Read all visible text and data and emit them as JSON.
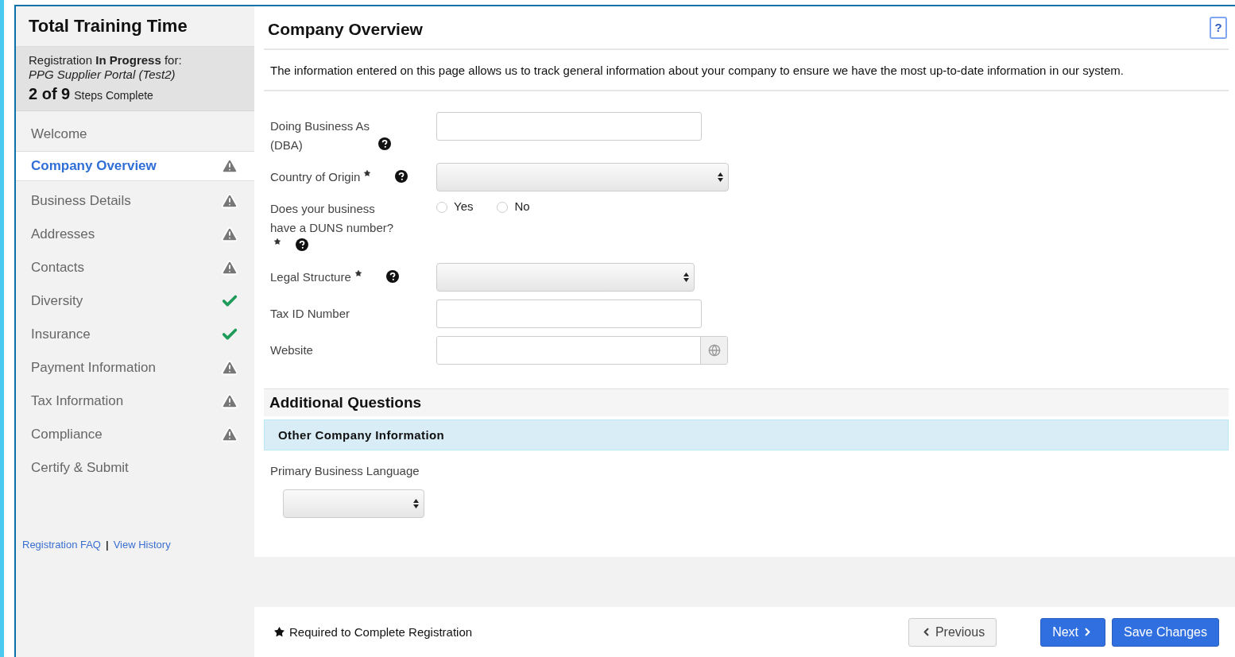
{
  "sidebar": {
    "title": "Total Training Time",
    "status": "Registration **In Progress** for:",
    "portal": "PPG Supplier Portal (Test2)",
    "progress": "2 of 9",
    "progress_suffix": "Steps Complete",
    "steps": [
      {
        "label": "Welcome",
        "selected": false,
        "kind": "plain"
      },
      {
        "label": "Company Overview",
        "selected": true,
        "kind": "warning"
      },
      {
        "label": "Business Details",
        "selected": false,
        "kind": "warning"
      },
      {
        "label": "Addresses",
        "selected": false,
        "kind": "warning"
      },
      {
        "label": "Contacts",
        "selected": false,
        "kind": "warning"
      },
      {
        "label": "Diversity",
        "selected": false,
        "kind": "done"
      },
      {
        "label": "Insurance",
        "selected": false,
        "kind": "done"
      },
      {
        "label": "Payment Information",
        "selected": false,
        "kind": "warning"
      },
      {
        "label": "Tax Information",
        "selected": false,
        "kind": "warning"
      },
      {
        "label": "Compliance",
        "selected": false,
        "kind": "warning"
      },
      {
        "label": "Certify & Submit",
        "selected": false,
        "kind": "plain"
      }
    ],
    "links": [
      "Registration FAQ",
      "View History"
    ],
    "link_separator": "|"
  },
  "main": {
    "title": "Company Overview",
    "help_button": "?",
    "intro": "The information entered on this page allows us to track general information about your company to ensure we have the most up-to-date information in our system.",
    "fields": [
      {
        "kind": "text",
        "label": "Doing Business As (DBA)",
        "required": false,
        "help": true
      },
      {
        "kind": "select",
        "label": "Country of Origin",
        "required": true,
        "help": true
      },
      {
        "kind": "radio",
        "label": "Does your business have a DUNS number?",
        "required": true,
        "help": true,
        "options": [
          {
            "label": "Yes",
            "selected": false
          },
          {
            "label": "No",
            "selected": false
          }
        ]
      },
      {
        "kind": "select",
        "label": "Legal Structure",
        "required": true,
        "help": true
      },
      {
        "kind": "text",
        "label": "Tax ID Number",
        "required": false,
        "help": false
      },
      {
        "kind": "url",
        "label": "Website",
        "required": false,
        "help": false
      }
    ],
    "additional": {
      "title": "Additional Questions",
      "subsection": "Other Company Information",
      "field": {
        "kind": "select",
        "label": "Primary Business Language"
      }
    }
  },
  "footer": {
    "legend": "Required to Complete Registration",
    "buttons": [
      {
        "label": "Previous",
        "kind": "secondary"
      },
      {
        "label": "Next",
        "kind": "primary"
      },
      {
        "label": "Save Changes",
        "kind": "primary"
      }
    ]
  }
}
